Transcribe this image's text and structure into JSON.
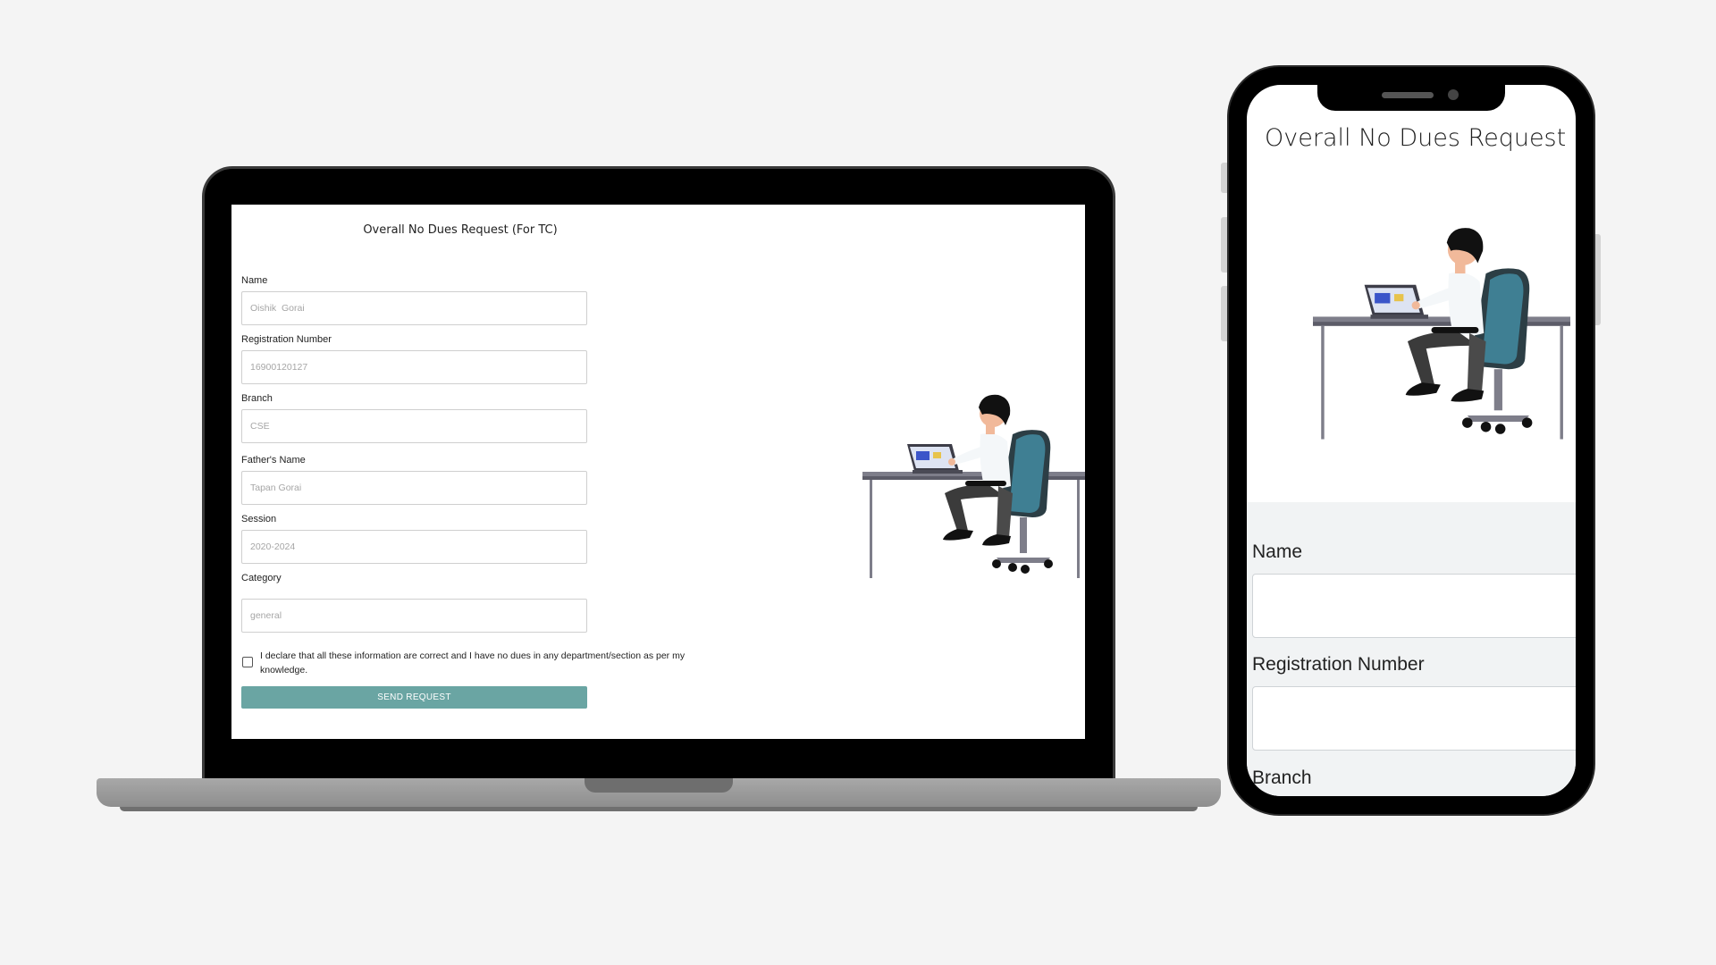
{
  "laptop": {
    "form": {
      "title": "Overall No Dues Request (For TC)",
      "fields": [
        {
          "label": "Name",
          "placeholder": "Oishik  Gorai"
        },
        {
          "label": "Registration Number",
          "placeholder": "16900120127"
        },
        {
          "label": "Branch",
          "placeholder": "CSE"
        },
        {
          "label": "Father's Name",
          "placeholder": "Tapan Gorai"
        },
        {
          "label": "Session",
          "placeholder": "2020-2024"
        },
        {
          "label": "Category",
          "placeholder": "general"
        }
      ],
      "declaration": "I declare that all these information are correct and I have no dues in any department/section as per my knowledge.",
      "declaration_checked": false,
      "submit_label": "SEND REQUEST"
    }
  },
  "phone": {
    "title": "Overall No Dues Request",
    "fields": [
      {
        "label": "Name"
      },
      {
        "label": "Registration Number"
      },
      {
        "label": "Branch"
      }
    ]
  },
  "colors": {
    "submit_button": "#6aa5a3",
    "chair": "#2f5e6e",
    "desk": "#7e7e8a"
  },
  "icons": [
    "person-at-desk-illustration"
  ]
}
